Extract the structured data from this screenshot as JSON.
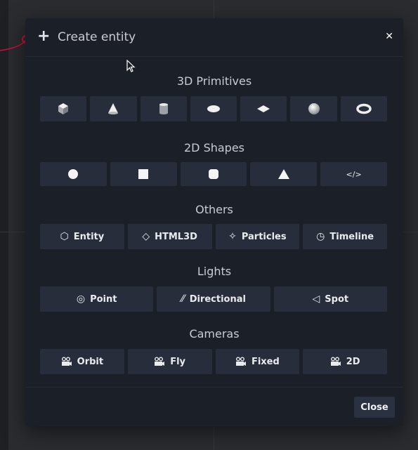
{
  "dialog": {
    "title": "Create entity",
    "close_label": "Close"
  },
  "sections": {
    "primitives": {
      "title": "3D Primitives",
      "items": [
        "cube-icon",
        "cone-icon",
        "cylinder-icon",
        "ellipse-icon",
        "plane-icon",
        "sphere-icon",
        "torus-icon"
      ]
    },
    "shapes": {
      "title": "2D Shapes",
      "items": [
        "circle-icon",
        "square-icon",
        "rounded-square-icon",
        "triangle-icon",
        "code-icon"
      ],
      "code_glyph": "</>"
    },
    "others": {
      "title": "Others",
      "items": [
        {
          "label": "Entity",
          "icon": "hexagon-icon",
          "glyph": "⬡"
        },
        {
          "label": "HTML3D",
          "icon": "diamond-icon",
          "glyph": "◇"
        },
        {
          "label": "Particles",
          "icon": "particles-icon",
          "glyph": "✧"
        },
        {
          "label": "Timeline",
          "icon": "timer-icon",
          "glyph": "◷"
        }
      ]
    },
    "lights": {
      "title": "Lights",
      "items": [
        {
          "label": "Point",
          "icon": "target-icon",
          "glyph": "◎"
        },
        {
          "label": "Directional",
          "icon": "directional-light-icon",
          "glyph": "⁄⁄"
        },
        {
          "label": "Spot",
          "icon": "spot-light-icon",
          "glyph": "◁"
        }
      ]
    },
    "cameras": {
      "title": "Cameras",
      "items": [
        {
          "label": "Orbit",
          "icon": "camera-icon"
        },
        {
          "label": "Fly",
          "icon": "camera-icon"
        },
        {
          "label": "Fixed",
          "icon": "camera-icon"
        },
        {
          "label": "2D",
          "icon": "camera-icon"
        }
      ]
    }
  },
  "colors": {
    "dialog_bg": "#1b1f28",
    "button_bg": "#272d3a",
    "connector": "#d0103a"
  }
}
